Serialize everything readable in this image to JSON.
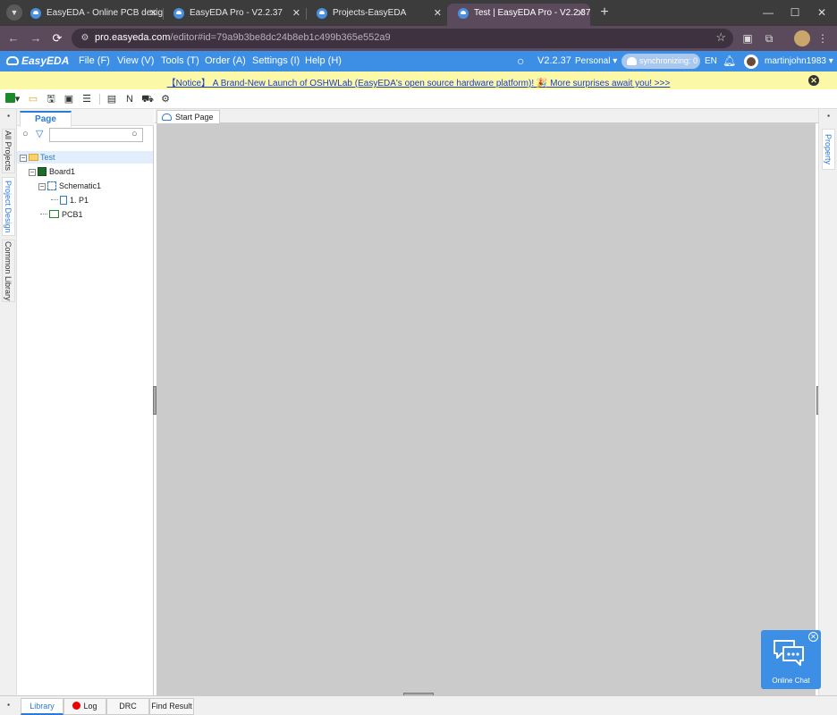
{
  "browser": {
    "tabs": [
      {
        "title": "EasyEDA - Online PCB design"
      },
      {
        "title": "EasyEDA Pro - V2.2.37"
      },
      {
        "title": "Projects-EasyEDA"
      },
      {
        "title": "Test | EasyEDA Pro - V2.2.37"
      }
    ],
    "url_host": "pro.easyeda.com",
    "url_path": "/editor#id=79a9b3be8dc24b8eb1c499b365e552a9"
  },
  "app": {
    "logo": "EasyEDA",
    "menus": [
      "File (F)",
      "View (V)",
      "Tools (T)",
      "Order (A)",
      "Settings (I)",
      "Help (H)"
    ],
    "version": "V2.2.37",
    "workspace": "Personal",
    "sync_label": "synchronizing: 0",
    "language": "EN",
    "username": "martinjohn1983"
  },
  "notice": {
    "text": "【Notice】 A Brand-New Launch of OSHWLab (EasyEDA's open source hardware platform)! 🎉 More surprises await you! >>>"
  },
  "left_rail": {
    "tabs": [
      "All Projects",
      "Project Design",
      "Common Library"
    ]
  },
  "panel": {
    "tab": "Page",
    "search_placeholder": "",
    "tree": {
      "project": "Test",
      "board": "Board1",
      "schematic": "Schematic1",
      "page": "1. P1",
      "pcb": "PCB1"
    }
  },
  "doc_tabs": [
    "Start Page"
  ],
  "right_rail": {
    "tab": "Property"
  },
  "bottom_tabs": [
    "Library",
    "Log",
    "DRC",
    "Find Result"
  ],
  "chat": {
    "label": "Online Chat"
  },
  "colors": {
    "accent": "#3d8fe6",
    "notice_bg": "#fbf8a8",
    "canvas": "#cbcbcb"
  }
}
